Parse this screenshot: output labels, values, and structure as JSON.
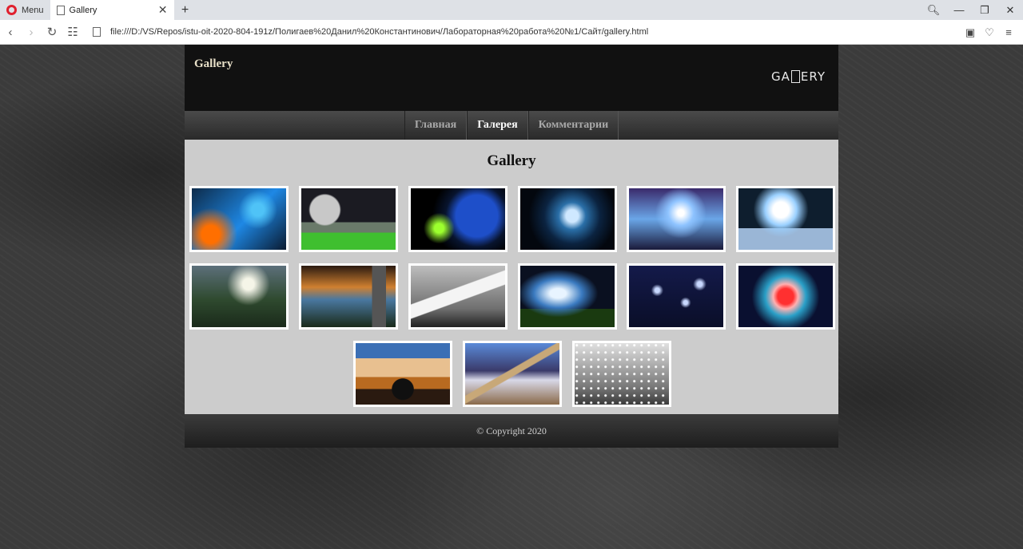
{
  "browser": {
    "menu_label": "Menu",
    "tab_title": "Gallery",
    "tab_close": "✕",
    "new_tab": "+",
    "url": "file:///D:/VS/Repos/istu-oit-2020-804-191z/Полигаев%20Данил%20Константинович/Лабораторная%20работа%20№1/Сайт/gallery.html"
  },
  "site": {
    "title": "Gallery",
    "logo_left": "GA",
    "logo_right": "ERY",
    "nav": [
      {
        "label": "Главная",
        "active": false
      },
      {
        "label": "Галерея",
        "active": true
      },
      {
        "label": "Комментарии",
        "active": false
      }
    ],
    "heading": "Gallery",
    "gallery": [
      {
        "icon": "space-image"
      },
      {
        "icon": "moon-field-image"
      },
      {
        "icon": "planet-image"
      },
      {
        "icon": "blue-planet-image"
      },
      {
        "icon": "nebula-image"
      },
      {
        "icon": "ice-planet-image"
      },
      {
        "icon": "valley-image"
      },
      {
        "icon": "castle-image"
      },
      {
        "icon": "sailboat-image"
      },
      {
        "icon": "sky-image"
      },
      {
        "icon": "stars-image"
      },
      {
        "icon": "fantasy-sphere-image"
      },
      {
        "icon": "bridge-image"
      },
      {
        "icon": "great-wall-image"
      },
      {
        "icon": "eiffel-rain-image"
      }
    ],
    "footer": "© Copyright 2020"
  }
}
